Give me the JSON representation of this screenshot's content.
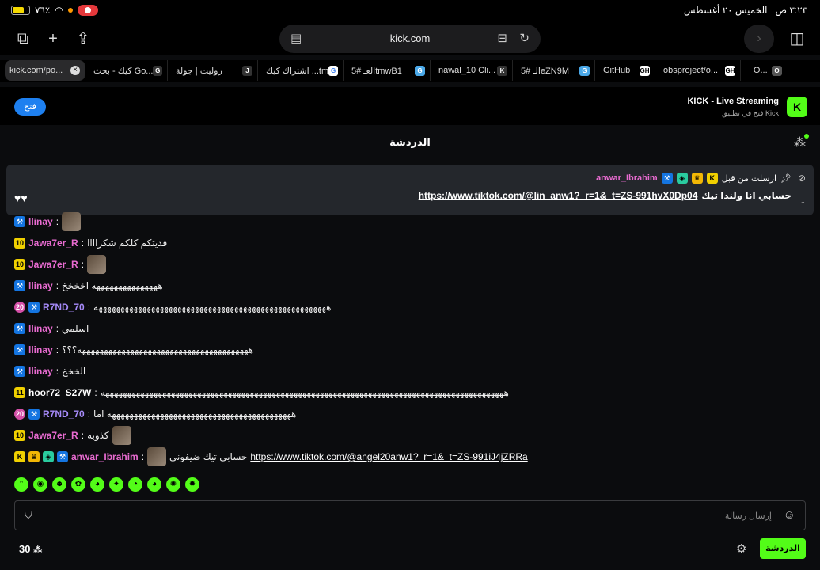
{
  "status": {
    "battery": "٧٦٪",
    "time": "٣:٢٣ ص",
    "date": "الخميس ٢٠ أغسطس"
  },
  "browser": {
    "url": "kick.com",
    "forward": "›"
  },
  "tabs": [
    {
      "label": "kick.com/po...",
      "icon": "K",
      "close": "×"
    },
    {
      "label": "كيك - بحث Go...",
      "icon": "G"
    },
    {
      "label": "روليت | جولة",
      "icon": "J"
    },
    {
      "label": "اشتراك كيك ...tm",
      "icon": "G"
    },
    {
      "label": "العـ #5tmwB1",
      "icon": "G"
    },
    {
      "label": "nawal_10 Cli...",
      "icon": "K"
    },
    {
      "label": "الـ #5eZN9M",
      "icon": "G"
    },
    {
      "label": "GitHub",
      "icon": "GH"
    },
    {
      "label": "obsproject/o...",
      "icon": "GH"
    },
    {
      "label": "| O...",
      "icon": "O"
    }
  ],
  "banner": {
    "open": "فتح",
    "title": "KICK - Live Streaming",
    "subtitle": "فتح في تطبيق Kick",
    "logo": "K"
  },
  "chat_header": {
    "title": "الدردشة"
  },
  "pinned": {
    "user": "anwar_Ibrahim",
    "label": "ارسلت من قبل",
    "text": "حسابي انا ولندا تيك",
    "link": "https://www.tiktok.com/@lin_anw1?_r=1&_t=ZS-991hvX0Dp04"
  },
  "messages": [
    {
      "user": "llinay",
      "color": "#e86bd0",
      "text": "",
      "badges": [
        "mod"
      ],
      "thumb": true
    },
    {
      "user": "Jawa7er_R",
      "color": "#e86bd0",
      "text": "فديتكم كلكم شكراااا",
      "badges": [
        "sub"
      ]
    },
    {
      "user": "Jawa7er_R",
      "color": "#e86bd0",
      "text": "",
      "badges": [
        "sub"
      ],
      "thumb": true
    },
    {
      "user": "llinay",
      "color": "#e86bd0",
      "text": "هههههههههههههههه اخخخخ",
      "badges": [
        "mod"
      ]
    },
    {
      "user": "R7ND_70",
      "color": "#a78bfa",
      "text": "هههههههههههههههههههههههههههههههههههههههههههههههههههههه",
      "badges": [
        "20",
        "mod"
      ]
    },
    {
      "user": "llinay",
      "color": "#e86bd0",
      "text": "اسلمي",
      "badges": [
        "mod"
      ]
    },
    {
      "user": "llinay",
      "color": "#e86bd0",
      "text": "هههههههههههههههههههههههههههههههههههههههه؟؟؟",
      "badges": [
        "mod"
      ]
    },
    {
      "user": "llinay",
      "color": "#e86bd0",
      "text": "الخخخ",
      "badges": [
        "mod"
      ]
    },
    {
      "user": "hoor72_S27W",
      "color": "#ffffff",
      "text": "ههههههههههههههههههههههههههههههههههههههههههههههههههههههههههههههههههههههههههههههههههههههههههههه",
      "badges": [
        "sub"
      ]
    },
    {
      "user": "R7ND_70",
      "color": "#a78bfa",
      "text": "ههههههههههههههههههههههههههههههههههههههههههه اما",
      "badges": [
        "20",
        "mod"
      ]
    },
    {
      "user": "Jawa7er_R",
      "color": "#e86bd0",
      "text": "كذوبه",
      "badges": [
        "sub"
      ],
      "thumb": true
    },
    {
      "user": "anwar_Ibrahim",
      "color": "#e86bd0",
      "text": "حسابي تيك ضيفوني",
      "badges": [
        "sub",
        "crown",
        "vip",
        "mod"
      ],
      "thumb": true,
      "link": "https://www.tiktok.com/@angel20anw1?_r=1&_t=ZS-991iJ4jZRRa"
    }
  ],
  "emotes": [
    "ᵔ",
    "◉",
    "☻",
    "✿",
    "◕",
    "✦",
    "◔",
    "◕",
    "✺",
    "✹"
  ],
  "input": {
    "placeholder": "إرسال رسالة"
  },
  "footer": {
    "count": "30",
    "chat_button": "الدردشة"
  }
}
